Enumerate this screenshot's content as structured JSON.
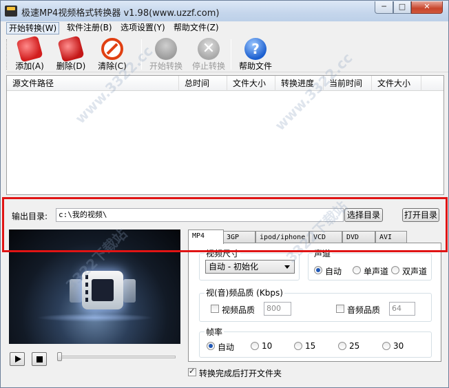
{
  "window": {
    "title": "极速MP4视频格式转换器 v1.98(www.uzzf.com)",
    "icon_text": "MP4",
    "minimize": "─",
    "maximize": "□",
    "close": "✕"
  },
  "menu": [
    {
      "label": "开始转换(W)"
    },
    {
      "label": "软件注册(B)"
    },
    {
      "label": "选项设置(Y)"
    },
    {
      "label": "帮助文件(Z)"
    }
  ],
  "toolbar": {
    "add": "添加(A)",
    "delete": "删除(D)",
    "clear": "清除(C)",
    "start": "开始转换",
    "stop": "停止转换",
    "help": "帮助文件",
    "stop_glyph": "✕",
    "help_glyph": "?"
  },
  "file_list": {
    "columns": [
      "源文件路径",
      "总时间",
      "文件大小",
      "转换进度",
      "当前时间",
      "文件大小"
    ],
    "rows": []
  },
  "output": {
    "label": "输出目录:",
    "value": "c:\\我的视频\\",
    "choose_button": "选择目录",
    "open_button": "打开目录"
  },
  "tabs": [
    "MP4",
    "3GP",
    "ipod/iphone",
    "VCD",
    "DVD",
    "AVI"
  ],
  "active_tab": "MP4",
  "video_size": {
    "title": "视频尺寸",
    "selected": "自动 - 初始化"
  },
  "audio_channel": {
    "title": "声道",
    "options": [
      "自动",
      "单声道",
      "双声道"
    ],
    "selected": "自动"
  },
  "quality": {
    "title": "视(音)频品质 (Kbps)",
    "video_label": "视频品质",
    "video_checked": false,
    "video_value": "800",
    "audio_label": "音频品质",
    "audio_checked": false,
    "audio_value": "64"
  },
  "framerate": {
    "title": "帧率",
    "options": [
      "自动",
      "10",
      "15",
      "25",
      "30"
    ],
    "selected": "自动"
  },
  "open_after": {
    "label": "转换完成后打开文件夹",
    "checked": true
  },
  "watermark_text": "www.3322.cc",
  "watermark_text_2": "3322下载站",
  "colors": {
    "highlight_box": "#e01414",
    "accent": "#1f57b5"
  }
}
